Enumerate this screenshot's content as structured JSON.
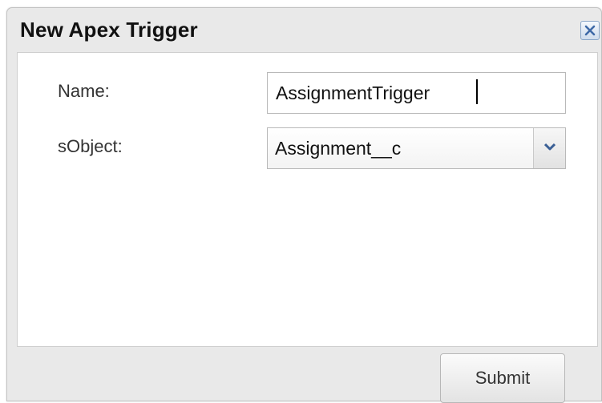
{
  "dialog": {
    "title": "New Apex Trigger",
    "close_icon": "close-icon"
  },
  "form": {
    "name_label": "Name:",
    "name_value": "AssignmentTrigger",
    "sobject_label": "sObject:",
    "sobject_value": "Assignment__c",
    "dropdown_icon": "chevron-down-icon"
  },
  "footer": {
    "submit_label": "Submit"
  },
  "colors": {
    "dialog_bg": "#e9e9e9",
    "panel_bg": "#ffffff",
    "close_border": "#8aa6c8",
    "close_x": "#3f6aa7",
    "chevron": "#3a5f95"
  }
}
